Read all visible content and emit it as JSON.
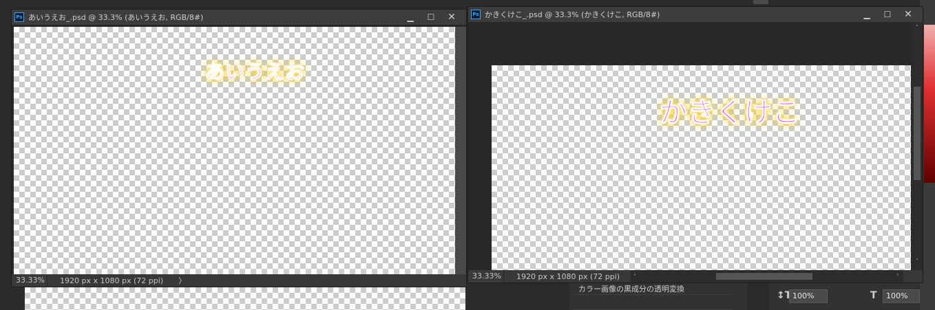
{
  "window1": {
    "title": "あいうえお_.psd @ 33.3% (あいうえお, RGB/8#)",
    "canvas_text": "あいうえお",
    "status_zoom": "33.33%",
    "status_info": "1920 px x 1080 px (72 ppi)",
    "status_arrow": "〉"
  },
  "window2": {
    "title": "かきくけこ_.psd @ 33.3% (かきくけこ, RGB/8#)",
    "canvas_text": "かきくけこ",
    "status_zoom": "33.33%",
    "status_info": "1920 px x 1080 px (72 ppi)",
    "status_arrow": "〉",
    "hscroll_left": "‹",
    "hscroll_right": "›",
    "vscroll_up": "˄",
    "vscroll_down": "˅"
  },
  "common": {
    "ps_icon": "Ps",
    "minimize": "▁",
    "maximize": "☐",
    "close": "✕"
  },
  "panels": {
    "layer_item_text": "カラー画像の黒成分の透明変換",
    "leading_value": "100%",
    "tracking_value": "100%"
  },
  "colors": {
    "text_fill": "#ff3fd0",
    "text_glow": "#ffd43b",
    "panel_bg": "#2b2b2b",
    "titlebar_bg": "#3d3d3d"
  },
  "icons": [
    "photoshop-document-icon",
    "minimize-icon",
    "maximize-icon",
    "close-icon",
    "vertical-scale-icon",
    "horizontal-scale-icon"
  ]
}
